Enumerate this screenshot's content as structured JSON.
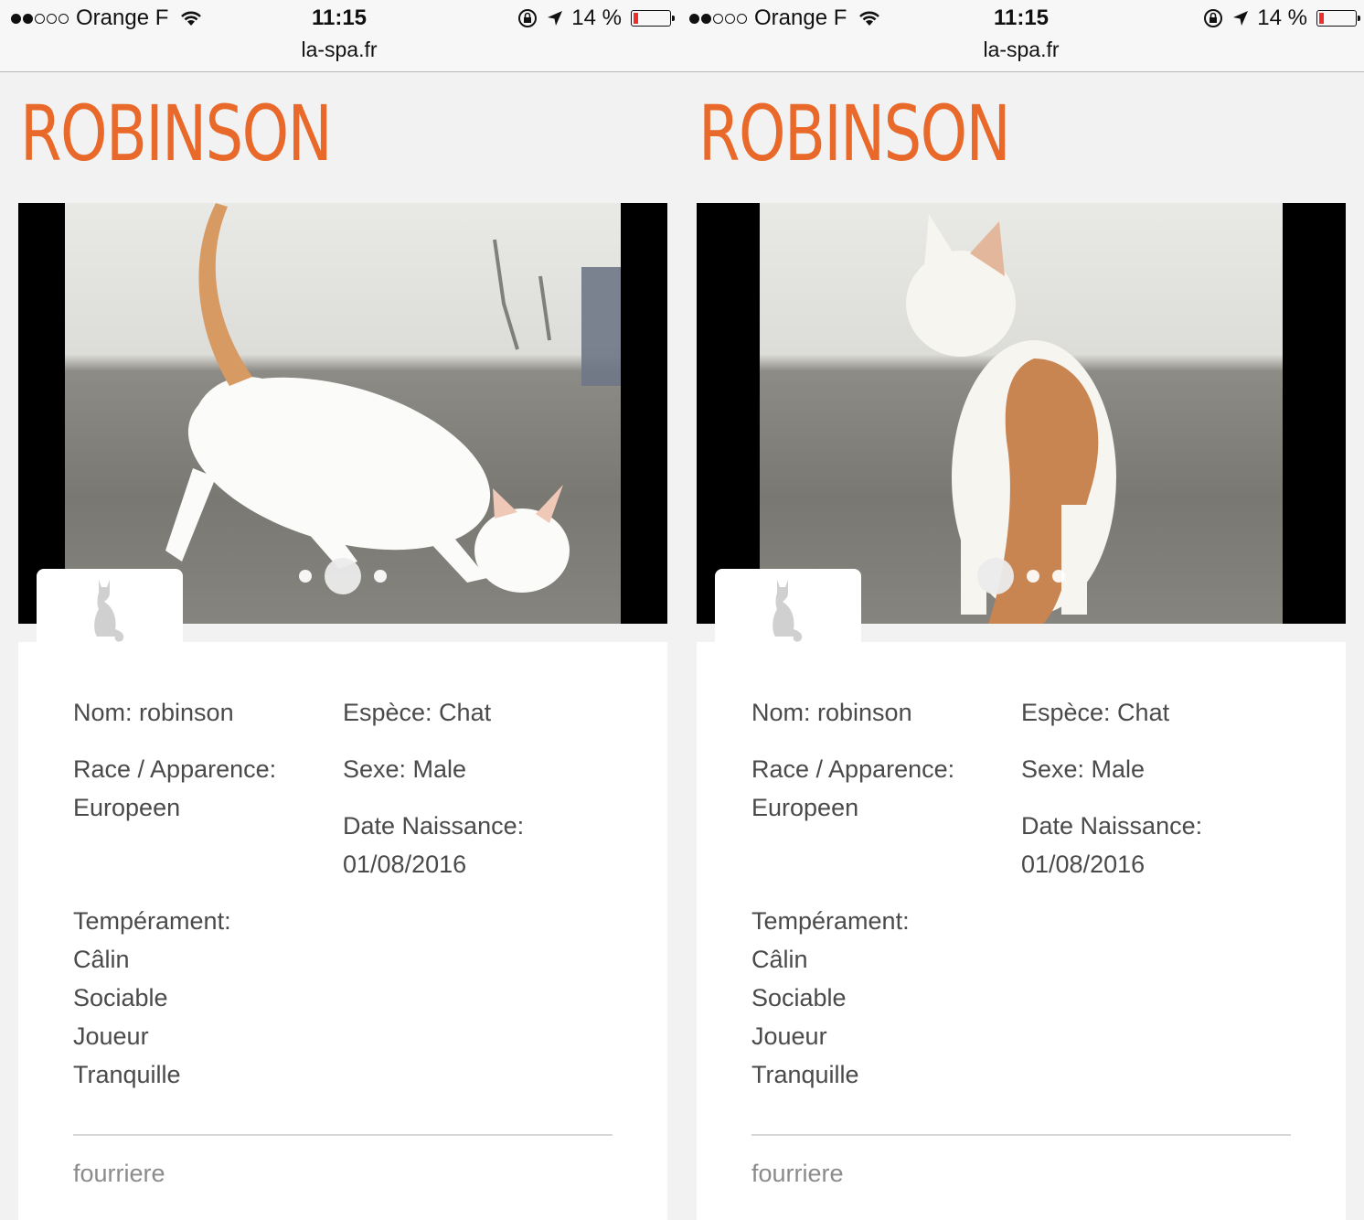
{
  "status_bar": {
    "carrier": "Orange F",
    "time": "11:15",
    "url": "la-spa.fr",
    "battery": "14 %",
    "battery_level": 0.14
  },
  "pet": {
    "title": "ROBINSON",
    "nom": "Nom: robinson",
    "espece": "Espèce: Chat",
    "race_label": "Race / Apparence:",
    "race_value": "Europeen",
    "sexe": "Sexe: Male",
    "date_label": "Date Naissance:",
    "date_value": "01/08/2016",
    "temperament_label": "Tempérament:",
    "temperament": [
      "Câlin",
      "Sociable",
      "Joueur",
      "Tranquille"
    ],
    "origin": "fourriere"
  },
  "carousel": {
    "left_active_index": 1,
    "right_active_index": 0,
    "dot_count": 3
  },
  "icons": {
    "species": "cat-silhouette-icon",
    "wifi": "wifi-icon",
    "location": "location-arrow-icon",
    "rotation_lock": "rotation-lock-icon",
    "battery": "battery-icon"
  },
  "colors": {
    "title": "#e8692a",
    "battery_low": "#ef2d2d",
    "background": "#f2f2f2"
  }
}
